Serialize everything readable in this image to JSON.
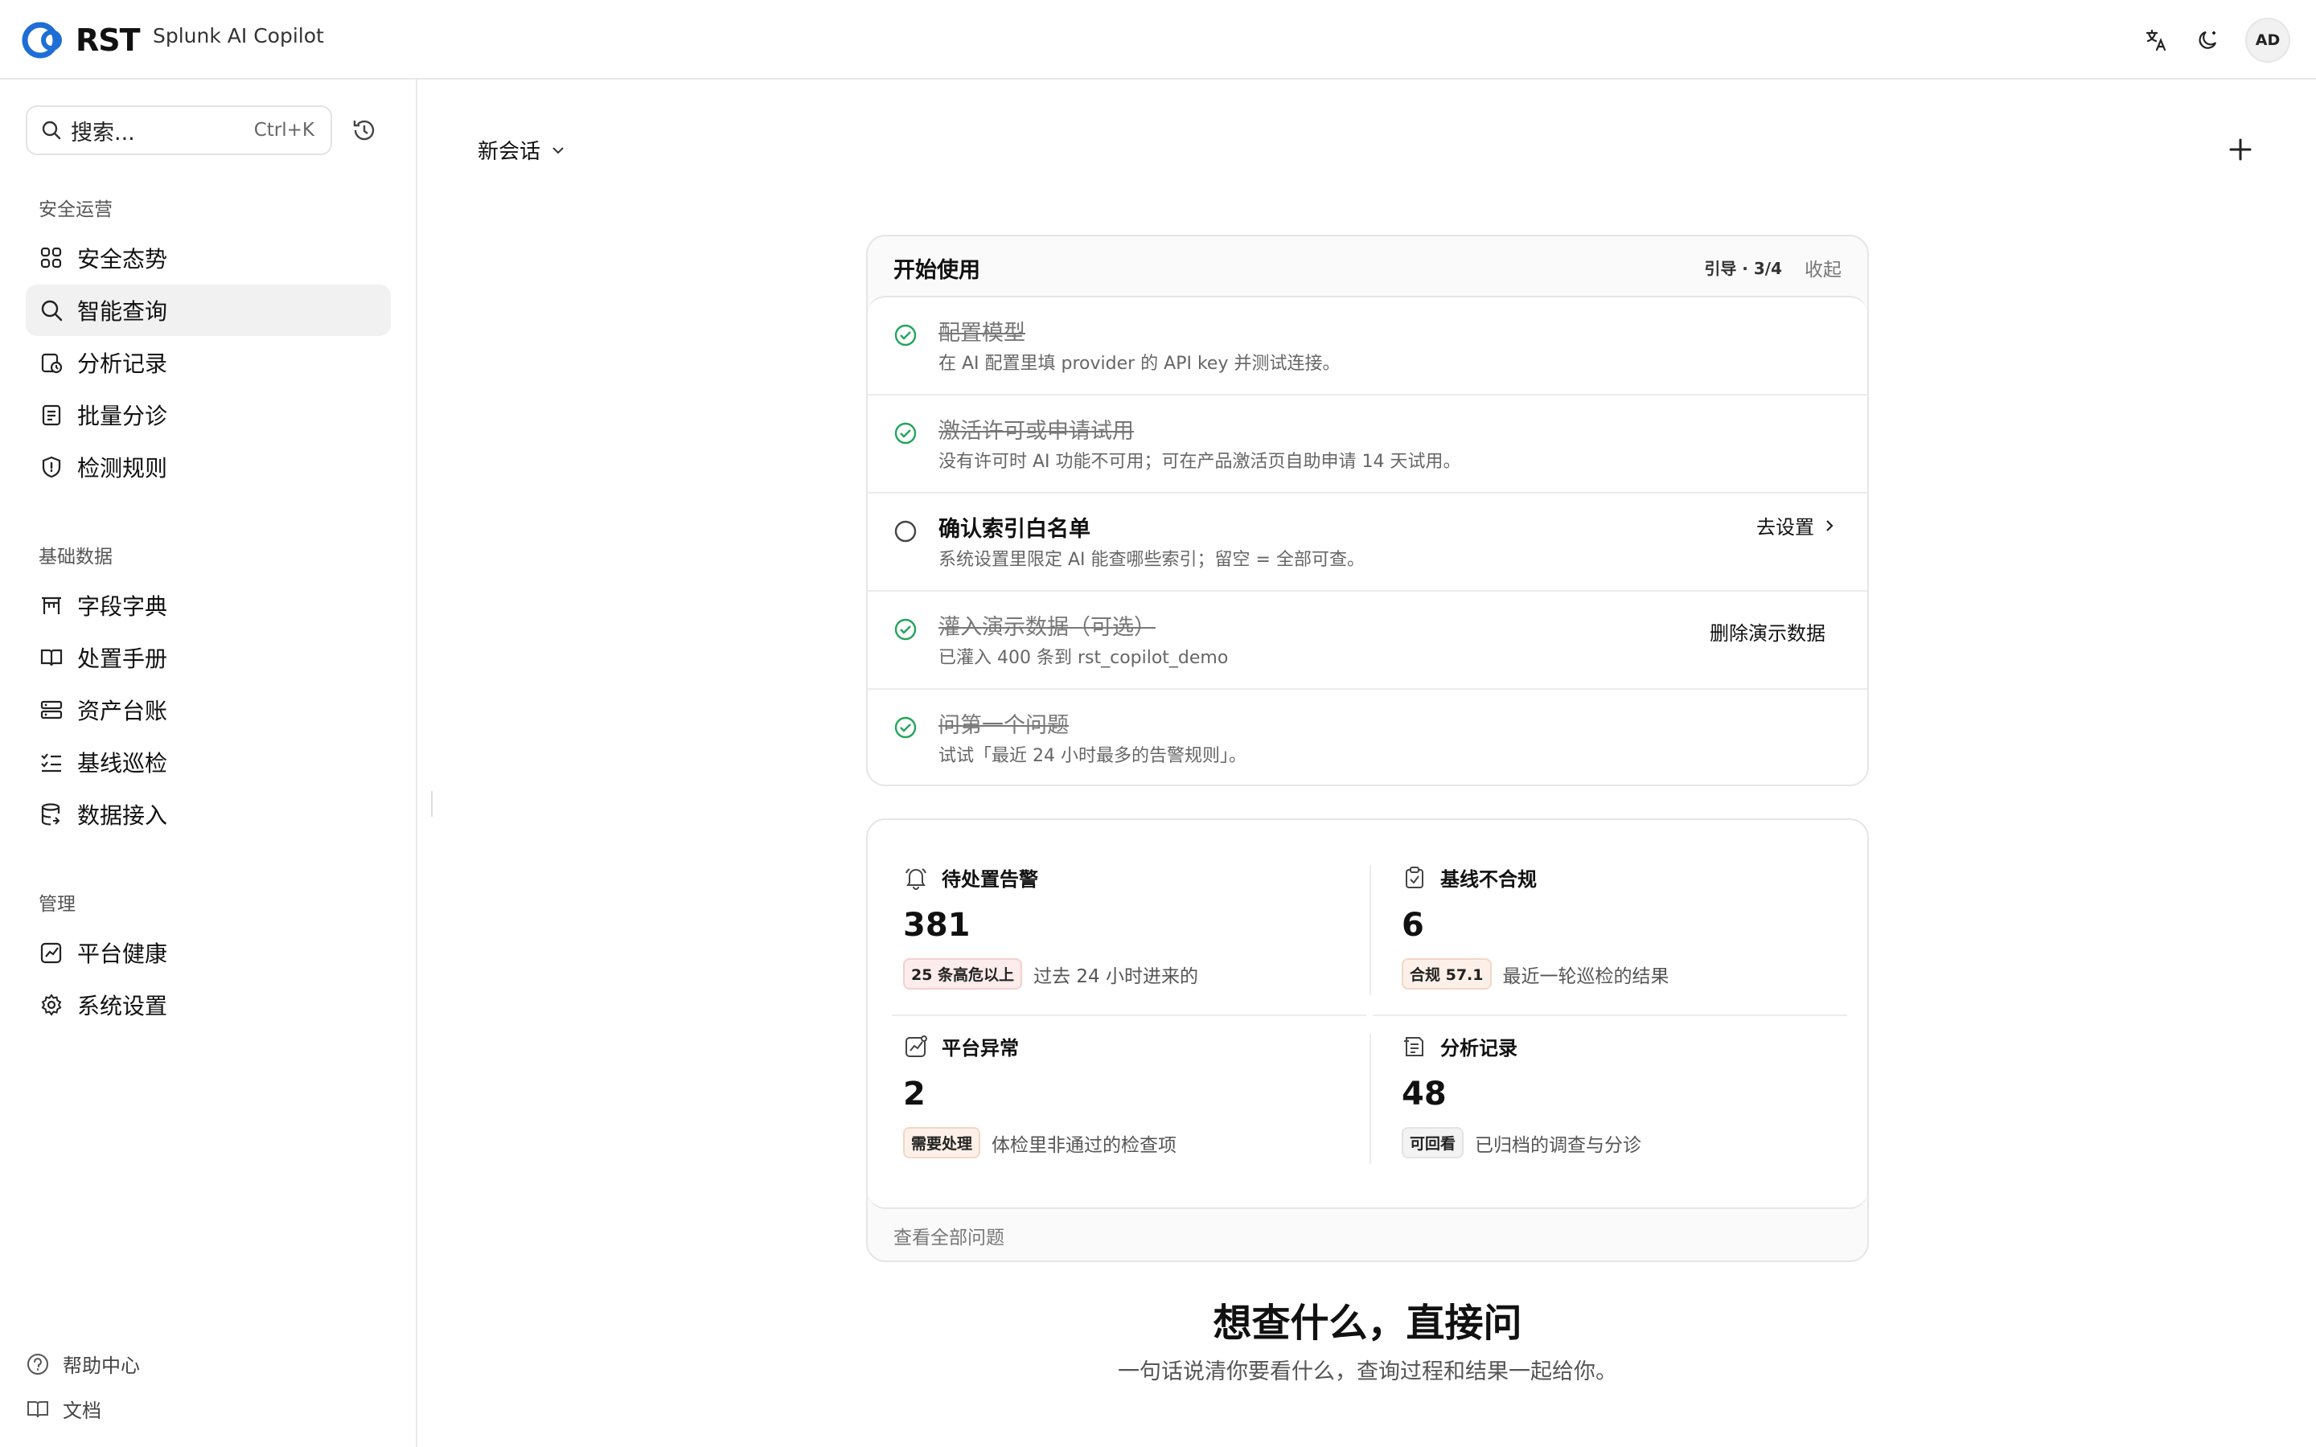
{
  "brand": {
    "logo_text": "RST",
    "app_name": "Splunk AI Copilot"
  },
  "topbar": {
    "avatar_initials": "AD",
    "icons": [
      "translate-icon",
      "theme-toggle-icon"
    ]
  },
  "sidebar": {
    "search_placeholder": "搜索...",
    "search_shortcut": "Ctrl+K",
    "sections": [
      {
        "title": "安全运营",
        "items": [
          {
            "label": "安全态势",
            "icon": "dashboard-grid-icon"
          },
          {
            "label": "智能查询",
            "icon": "search-icon",
            "active": true
          },
          {
            "label": "分析记录",
            "icon": "analysis-history-icon"
          },
          {
            "label": "批量分诊",
            "icon": "batch-triage-icon"
          },
          {
            "label": "检测规则",
            "icon": "shield-alert-icon"
          }
        ]
      },
      {
        "title": "基础数据",
        "items": [
          {
            "label": "字段字典",
            "icon": "field-dictionary-icon"
          },
          {
            "label": "处置手册",
            "icon": "book-icon"
          },
          {
            "label": "资产台账",
            "icon": "server-icon"
          },
          {
            "label": "基线巡检",
            "icon": "checklist-icon"
          },
          {
            "label": "数据接入",
            "icon": "database-icon"
          }
        ]
      },
      {
        "title": "管理",
        "items": [
          {
            "label": "平台健康",
            "icon": "health-chart-icon"
          },
          {
            "label": "系统设置",
            "icon": "gear-icon"
          }
        ]
      }
    ],
    "footer": [
      {
        "label": "帮助中心",
        "icon": "help-icon"
      },
      {
        "label": "文档",
        "icon": "docs-book-icon"
      }
    ]
  },
  "main": {
    "session_label": "新会话",
    "guide": {
      "title": "开始使用",
      "step": "引导 · 3/4",
      "collapse": "收起",
      "items": [
        {
          "title": "配置模型",
          "desc": "在 AI 配置里填 provider 的 API key 并测试连接。",
          "done": true,
          "action": ""
        },
        {
          "title": "激活许可或申请试用",
          "desc": "没有许可时 AI 功能不可用；可在产品激活页自助申请 14 天试用。",
          "done": true,
          "action": ""
        },
        {
          "title": "确认索引白名单",
          "desc": "系统设置里限定 AI 能查哪些索引；留空 = 全部可查。",
          "done": false,
          "action": "去设置"
        },
        {
          "title": "灌入演示数据（可选）",
          "desc": "已灌入 400 条到 rst_copilot_demo",
          "done": true,
          "action": "删除演示数据"
        },
        {
          "title": "问第一个问题",
          "desc": "试试「最近 24 小时最多的告警规则」。",
          "done": true,
          "action": ""
        }
      ]
    },
    "stats": [
      {
        "name": "待处置告警",
        "value": "381",
        "badge": "25 条高危以上",
        "badge_color": "#fdecec",
        "text": "过去 24 小时进来的",
        "icon": "bell-icon"
      },
      {
        "name": "基线不合规",
        "value": "6",
        "badge": "合规 57.1",
        "badge_color": "#fdf0e8",
        "text": "最近一轮巡检的结果",
        "icon": "clipboard-check-icon"
      },
      {
        "name": "平台异常",
        "value": "2",
        "badge": "需要处理",
        "badge_color": "#fdf0e8",
        "text": "体检里非通过的检查项",
        "icon": "trend-alert-icon"
      },
      {
        "name": "分析记录",
        "value": "48",
        "badge": "可回看",
        "badge_color": "#f3f3f3",
        "text": "已归档的调查与分诊",
        "icon": "archive-icon"
      }
    ],
    "view_all": "查看全部问题",
    "hero_title": "想查什么，直接问",
    "hero_subtitle": "一句话说清你要看什么，查询过程和结果一起给你。"
  },
  "colors": {
    "accent_blue": "#1e6ed6",
    "check_green": "#22a55a"
  }
}
